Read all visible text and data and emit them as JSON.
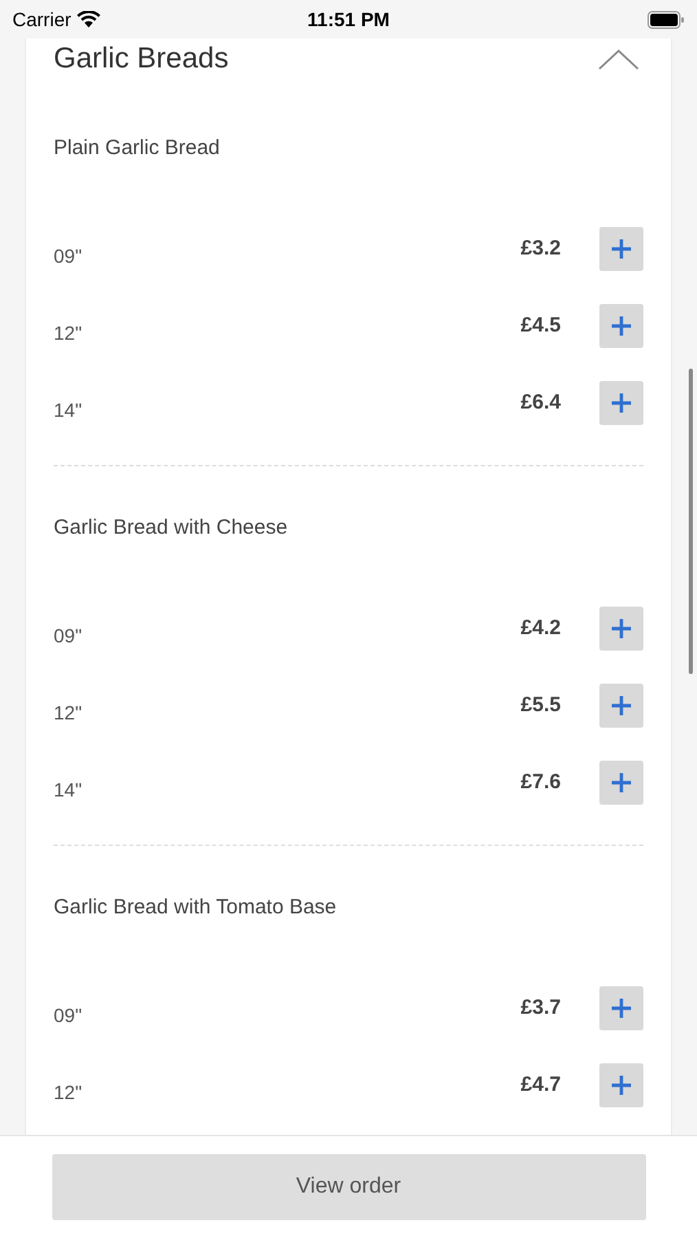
{
  "status_bar": {
    "carrier": "Carrier",
    "time": "11:51 PM"
  },
  "section": {
    "title": "Garlic Breads",
    "expanded": true,
    "groups": [
      {
        "name": "Plain Garlic Bread",
        "options": [
          {
            "size": "09\"",
            "price": "£3.2"
          },
          {
            "size": "12\"",
            "price": "£4.5"
          },
          {
            "size": "14\"",
            "price": "£6.4"
          }
        ]
      },
      {
        "name": "Garlic Bread with Cheese",
        "options": [
          {
            "size": "09\"",
            "price": "£4.2"
          },
          {
            "size": "12\"",
            "price": "£5.5"
          },
          {
            "size": "14\"",
            "price": "£7.6"
          }
        ]
      },
      {
        "name": "Garlic Bread with Tomato Base",
        "options": [
          {
            "size": "09\"",
            "price": "£3.7"
          },
          {
            "size": "12\"",
            "price": "£4.7"
          }
        ]
      }
    ]
  },
  "footer": {
    "button": "View order"
  }
}
